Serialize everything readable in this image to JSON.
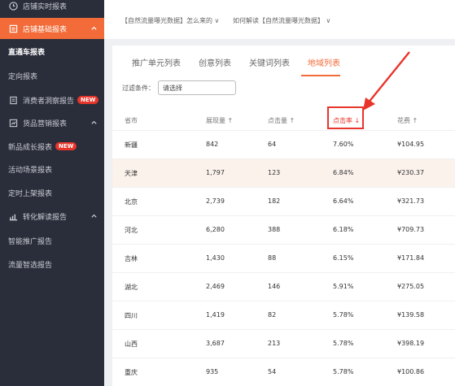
{
  "sidebar": {
    "realtime": "店铺实时报表",
    "basic": "店铺基础报表",
    "zhitongche": "直通车报表",
    "dingxiang": "定向报表",
    "consumer": "消费者洞察报告",
    "product_group": "货品营销报表",
    "new_growth": "新品成长报表",
    "activity": "活动场景报表",
    "schedule": "定时上架报表",
    "conversion": "转化解读报告",
    "smart": "智能推广报告",
    "traffic": "流量智选报告",
    "new_badge": "NEW"
  },
  "topbar": {
    "link1": "【自然流量曝光数据】怎么来的 ∨",
    "link2": "如何解读【自然流量曝光数据】 ∨"
  },
  "tabs": [
    "推广单元列表",
    "创意列表",
    "关键词列表",
    "地域列表"
  ],
  "filter": {
    "label": "过滤条件：",
    "value": "请选择"
  },
  "table": {
    "headers": [
      "省市",
      "展现量 ↑",
      "点击量 ↑",
      "点击率 ↓",
      "花费 ↑"
    ],
    "rows": [
      [
        "新疆",
        "842",
        "64",
        "7.60%",
        "¥104.95"
      ],
      [
        "天津",
        "1,797",
        "123",
        "6.84%",
        "¥230.37"
      ],
      [
        "北京",
        "2,739",
        "182",
        "6.64%",
        "¥321.73"
      ],
      [
        "河北",
        "6,280",
        "388",
        "6.18%",
        "¥709.73"
      ],
      [
        "吉林",
        "1,430",
        "88",
        "6.15%",
        "¥171.84"
      ],
      [
        "湖北",
        "2,469",
        "146",
        "5.91%",
        "¥275.05"
      ],
      [
        "四川",
        "1,419",
        "82",
        "5.78%",
        "¥139.58"
      ],
      [
        "山西",
        "3,687",
        "213",
        "5.78%",
        "¥398.19"
      ],
      [
        "重庆",
        "935",
        "54",
        "5.78%",
        "¥100.86"
      ]
    ]
  },
  "colors": {
    "accent": "#f26b38",
    "annotation": "#e8352b",
    "sidebar_bg": "#2a2e3b"
  }
}
